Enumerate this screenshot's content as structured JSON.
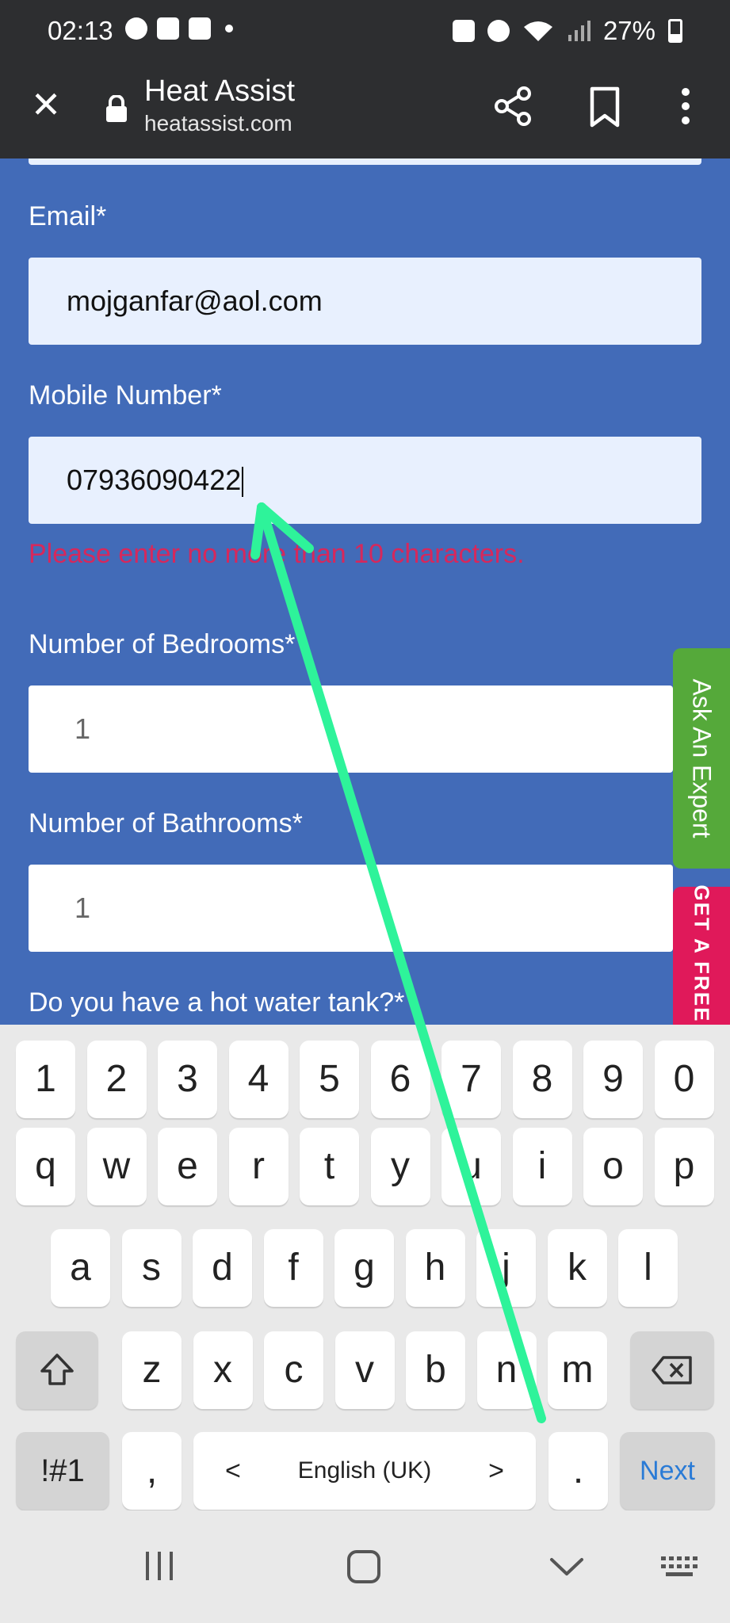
{
  "status_bar": {
    "time": "02:13",
    "battery": "27%"
  },
  "browser": {
    "title": "Heat Assist",
    "url": "heatassist.com"
  },
  "form": {
    "email_label": "Email*",
    "email_value": "mojganfar@aol.com",
    "mobile_label": "Mobile Number*",
    "mobile_value": "07936090422",
    "mobile_error": "Please enter no more than 10 characters.",
    "bedrooms_label": "Number of Bedrooms*",
    "bedrooms_value": "1",
    "bathrooms_label": "Number of Bathrooms*",
    "bathrooms_value": "1",
    "hot_water_label": "Do you have a hot water tank?*"
  },
  "side_tabs": {
    "ask_expert": "Ask An Expert",
    "free_quote": "GET A FREE ONLINE QUOTE"
  },
  "keyboard": {
    "row_numbers": [
      "1",
      "2",
      "3",
      "4",
      "5",
      "6",
      "7",
      "8",
      "9",
      "0"
    ],
    "row_q": [
      "q",
      "w",
      "e",
      "r",
      "t",
      "y",
      "u",
      "i",
      "o",
      "p"
    ],
    "row_a": [
      "a",
      "s",
      "d",
      "f",
      "g",
      "h",
      "j",
      "k",
      "l"
    ],
    "row_z": [
      "z",
      "x",
      "c",
      "v",
      "b",
      "n",
      "m"
    ],
    "symbols_label": "!#1",
    "comma": ",",
    "period": ".",
    "space_language": "English (UK)",
    "space_left": "<",
    "space_right": ">",
    "next_label": "Next"
  },
  "colors": {
    "page_bg": "#426bb8",
    "error": "#d6285c",
    "expert_tab": "#55a93a",
    "quote_tab": "#e0195a",
    "annotation": "#2ef39a"
  }
}
